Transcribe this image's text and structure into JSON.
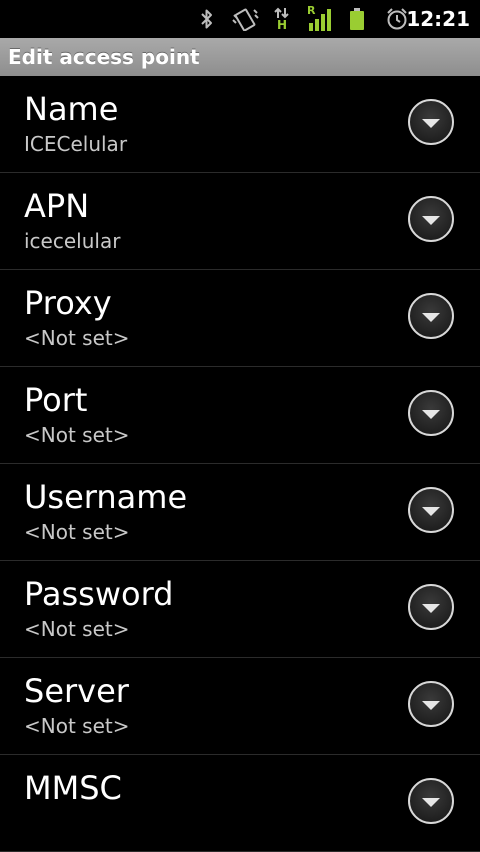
{
  "status_bar": {
    "time": "12:21",
    "icons": [
      "bluetooth-icon",
      "vibrate-icon",
      "data-hspa-icon",
      "signal-roaming-icon",
      "battery-icon",
      "alarm-icon"
    ],
    "roaming_indicator": "R",
    "network_type": "H",
    "accent_color": "#9ACD32"
  },
  "title_bar": {
    "title": "Edit access point"
  },
  "items": [
    {
      "label": "Name",
      "value": "ICECelular"
    },
    {
      "label": "APN",
      "value": "icecelular"
    },
    {
      "label": "Proxy",
      "value": "<Not set>"
    },
    {
      "label": "Port",
      "value": "<Not set>"
    },
    {
      "label": "Username",
      "value": "<Not set>"
    },
    {
      "label": "Password",
      "value": "<Not set>"
    },
    {
      "label": "Server",
      "value": "<Not set>"
    },
    {
      "label": "MMSC",
      "value": ""
    }
  ]
}
